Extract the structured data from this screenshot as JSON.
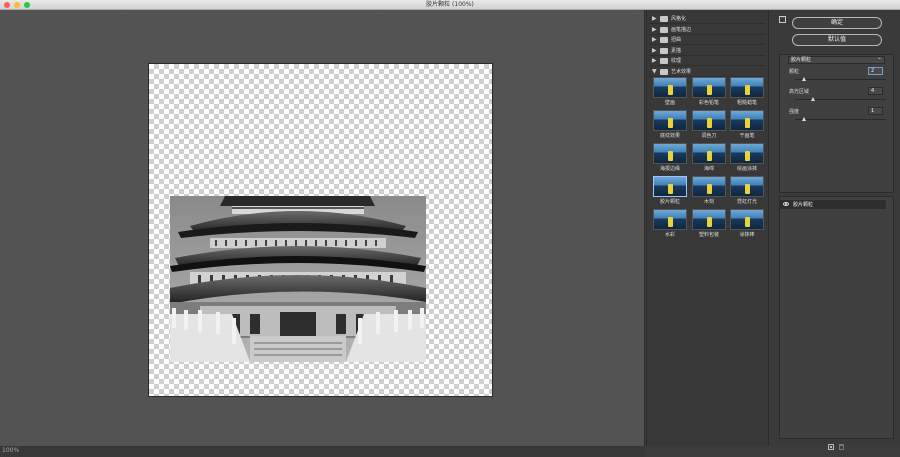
{
  "window": {
    "title": "胶片颗粒 (100%)"
  },
  "preview": {
    "zoom_label": "100%"
  },
  "gallery": {
    "categories": [
      {
        "label": "风格化",
        "expanded": false
      },
      {
        "label": "画笔描边",
        "expanded": false
      },
      {
        "label": "扭曲",
        "expanded": false
      },
      {
        "label": "素描",
        "expanded": false
      },
      {
        "label": "纹理",
        "expanded": false
      },
      {
        "label": "艺术效果",
        "expanded": true
      }
    ],
    "filters": [
      {
        "label": "壁画"
      },
      {
        "label": "彩色铅笔"
      },
      {
        "label": "粗糙蜡笔"
      },
      {
        "label": "底纹效果"
      },
      {
        "label": "调色刀"
      },
      {
        "label": "干画笔"
      },
      {
        "label": "海报边缘"
      },
      {
        "label": "海绵"
      },
      {
        "label": "绘画涂抹"
      },
      {
        "label": "胶片颗粒",
        "selected": true
      },
      {
        "label": "木刻"
      },
      {
        "label": "霓虹灯光"
      },
      {
        "label": "水彩"
      },
      {
        "label": "塑料包装"
      },
      {
        "label": "涂抹棒"
      }
    ]
  },
  "settings": {
    "ok_label": "确定",
    "default_label": "默认值",
    "selected_filter": "胶片颗粒",
    "params": [
      {
        "label": "颗粒",
        "value": "2",
        "level": 0.1
      },
      {
        "label": "高光区域",
        "value": "4",
        "level": 0.2
      },
      {
        "label": "强度",
        "value": "1",
        "level": 0.1
      }
    ]
  },
  "layers": {
    "items": [
      {
        "label": "胶片颗粒"
      }
    ]
  },
  "colors": {
    "accent": "#9bc6ff",
    "panel": "#3a3a3a",
    "preview_bg": "#535353"
  }
}
